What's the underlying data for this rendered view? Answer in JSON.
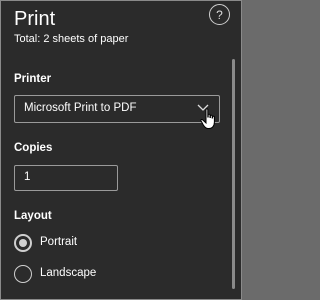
{
  "header": {
    "title": "Print",
    "subtitle": "Total: 2 sheets of paper",
    "help_glyph": "?"
  },
  "printer": {
    "label": "Printer",
    "selected": "Microsoft Print to PDF",
    "chevron_icon": "chevron-down-icon"
  },
  "copies": {
    "label": "Copies",
    "value": "1"
  },
  "layout": {
    "label": "Layout",
    "options": [
      {
        "label": "Portrait",
        "checked": true
      },
      {
        "label": "Landscape",
        "checked": false
      }
    ]
  },
  "colors": {
    "panel_background": "#2b2b2b",
    "text": "#ffffff",
    "border": "#9a9a9a"
  }
}
